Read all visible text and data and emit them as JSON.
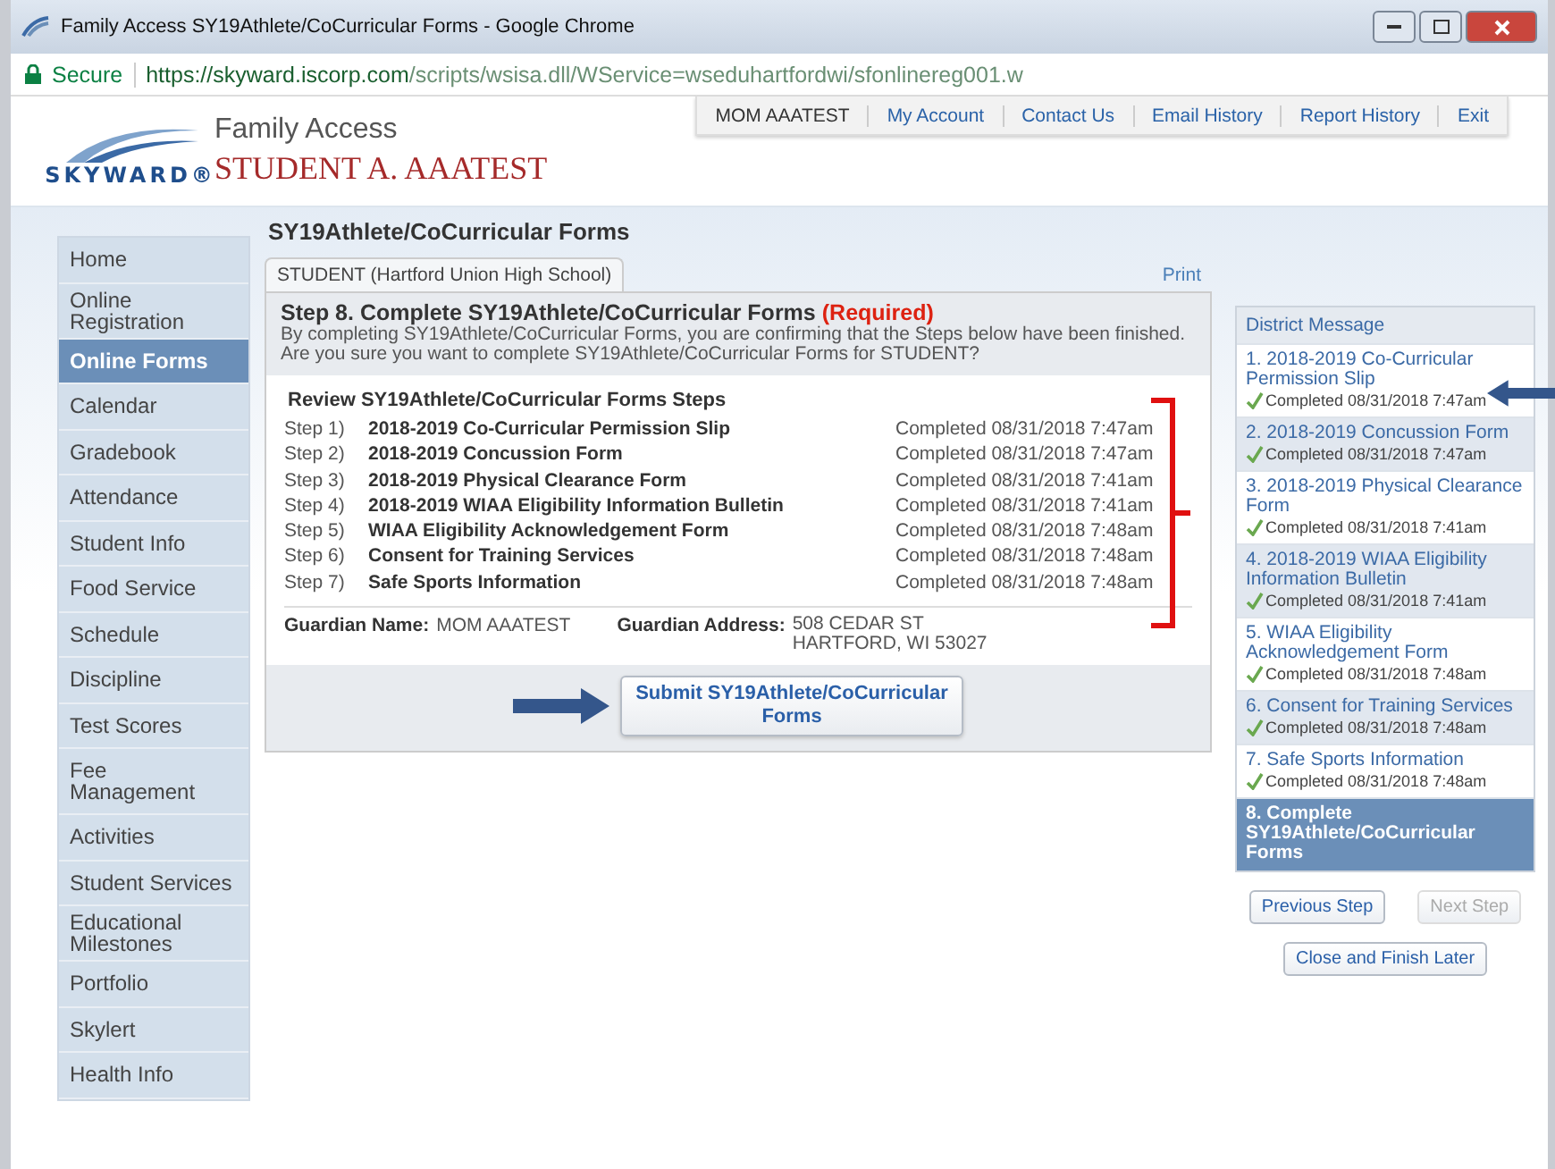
{
  "browser": {
    "title": "Family Access SY19Athlete/CoCurricular Forms - Google Chrome",
    "secure_label": "Secure",
    "url_host": "https://skyward.iscorp.com",
    "url_path": "/scripts/wsisa.dll/WService=wseduhartfordwi/sfonlinereg001.w"
  },
  "header": {
    "logo_text": "SKYWARD®",
    "app_name": "Family Access",
    "student_name": "STUDENT A. AAATEST",
    "user": "MOM AAATEST",
    "links": [
      "My Account",
      "Contact Us",
      "Email History",
      "Report History",
      "Exit"
    ]
  },
  "sidebar": {
    "items": [
      {
        "label": "Home",
        "selected": false
      },
      {
        "label": "Online Registration",
        "selected": false
      },
      {
        "label": "Online Forms",
        "selected": true
      },
      {
        "label": "Calendar",
        "selected": false
      },
      {
        "label": "Gradebook",
        "selected": false
      },
      {
        "label": "Attendance",
        "selected": false
      },
      {
        "label": "Student Info",
        "selected": false
      },
      {
        "label": "Food Service",
        "selected": false
      },
      {
        "label": "Schedule",
        "selected": false
      },
      {
        "label": "Discipline",
        "selected": false
      },
      {
        "label": "Test Scores",
        "selected": false
      },
      {
        "label": "Fee Management",
        "selected": false
      },
      {
        "label": "Activities",
        "selected": false
      },
      {
        "label": "Student Services",
        "selected": false
      },
      {
        "label": "Educational Milestones",
        "selected": false
      },
      {
        "label": "Portfolio",
        "selected": false
      },
      {
        "label": "Skylert",
        "selected": false
      },
      {
        "label": "Health Info",
        "selected": false
      }
    ]
  },
  "page_title": "SY19Athlete/CoCurricular Forms",
  "tabs": [
    {
      "label": "STUDENT (Hartford Union High School)",
      "selected": true
    }
  ],
  "print_link": "Print",
  "step": {
    "title": "Step 8. Complete SY19Athlete/CoCurricular Forms",
    "required": "(Required)",
    "description": [
      "By completing SY19Athlete/CoCurricular Forms, you are confirming that the Steps below have been finished.",
      "Are you sure you want to complete SY19Athlete/CoCurricular Forms for STUDENT?"
    ]
  },
  "review": {
    "title": "Review SY19Athlete/CoCurricular Forms Steps",
    "steps": [
      {
        "number": "Step 1)",
        "name": "2018-2019 Co-Curricular Permission Slip",
        "status": "Completed 08/31/2018 7:47am"
      },
      {
        "number": "Step 2)",
        "name": "2018-2019 Concussion Form",
        "status": "Completed 08/31/2018 7:47am"
      },
      {
        "number": "Step 3)",
        "name": "2018-2019 Physical Clearance Form",
        "status": "Completed 08/31/2018 7:41am"
      },
      {
        "number": "Step 4)",
        "name": "2018-2019 WIAA Eligibility Information Bulletin",
        "status": "Completed 08/31/2018 7:41am"
      },
      {
        "number": "Step 5)",
        "name": "WIAA Eligibility Acknowledgement Form",
        "status": "Completed 08/31/2018 7:48am"
      },
      {
        "number": "Step 6)",
        "name": "Consent for Training Services",
        "status": "Completed 08/31/2018 7:48am"
      },
      {
        "number": "Step 7)",
        "name": "Safe Sports Information",
        "status": "Completed 08/31/2018 7:48am"
      }
    ]
  },
  "guardian": {
    "name_label": "Guardian Name:",
    "name": "MOM AAATEST",
    "address_label": "Guardian Address:",
    "address_lines": [
      "508 CEDAR ST",
      "HARTFORD, WI 53027"
    ]
  },
  "submit_button": "Submit SY19Athlete/CoCurricular Forms",
  "step_panel": {
    "title": "District Message",
    "steps": [
      {
        "title": "1. 2018-2019 Co-Curricular Permission Slip",
        "completed": "Completed 08/31/2018 7:47am",
        "selected": false
      },
      {
        "title": "2. 2018-2019 Concussion Form",
        "completed": "Completed 08/31/2018 7:47am",
        "selected": false
      },
      {
        "title": "3. 2018-2019 Physical Clearance Form",
        "completed": "Completed 08/31/2018 7:41am",
        "selected": false
      },
      {
        "title": "4. 2018-2019 WIAA Eligibility Information Bulletin",
        "completed": "Completed 08/31/2018 7:41am",
        "selected": false
      },
      {
        "title": "5. WIAA Eligibility Acknowledgement Form",
        "completed": "Completed 08/31/2018 7:48am",
        "selected": false
      },
      {
        "title": "6. Consent for Training Services",
        "completed": "Completed 08/31/2018 7:48am",
        "selected": false
      },
      {
        "title": "7. Safe Sports Information",
        "completed": "Completed 08/31/2018 7:48am",
        "selected": false
      },
      {
        "title": "8. Complete SY19Athlete/CoCurricular Forms",
        "selected": true
      }
    ]
  },
  "nav_buttons": [
    {
      "label": "Previous Step",
      "disabled": false
    },
    {
      "label": "Next Step",
      "disabled": true
    }
  ],
  "close_button": "Close and Finish Later"
}
